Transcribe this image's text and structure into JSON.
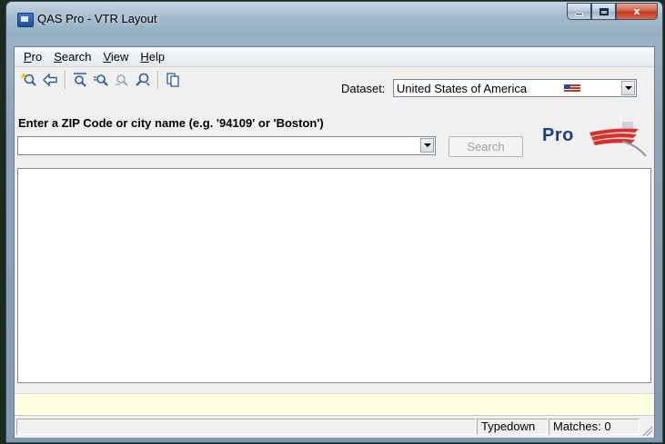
{
  "window": {
    "title": "QAS Pro - VTR Layout",
    "caption_close": "x"
  },
  "menu": [
    "Pro",
    "Search",
    "View",
    "Help"
  ],
  "toolbar": {
    "icons": [
      "new-search-icon",
      "back-arrow-icon",
      "zoom-in-icon",
      "zoom-out-icon",
      "refine-icon",
      "find-icon",
      "copy-icon"
    ]
  },
  "dataset": {
    "label": "Dataset:",
    "value": "United States of America",
    "flag": "us-flag-icon"
  },
  "lookup": {
    "prompt": "Enter a ZIP Code or city name (e.g. '94109' or 'Boston')",
    "value": "",
    "search_label": "Search",
    "search_enabled": false
  },
  "logo": {
    "text": "Pro"
  },
  "status": {
    "main": "",
    "typedown": "Typedown",
    "matches": "Matches: 0"
  },
  "colors": {
    "logo_blue": "#1f3c88",
    "logo_red": "#d9302a",
    "info_bar": "#ffffe1"
  }
}
